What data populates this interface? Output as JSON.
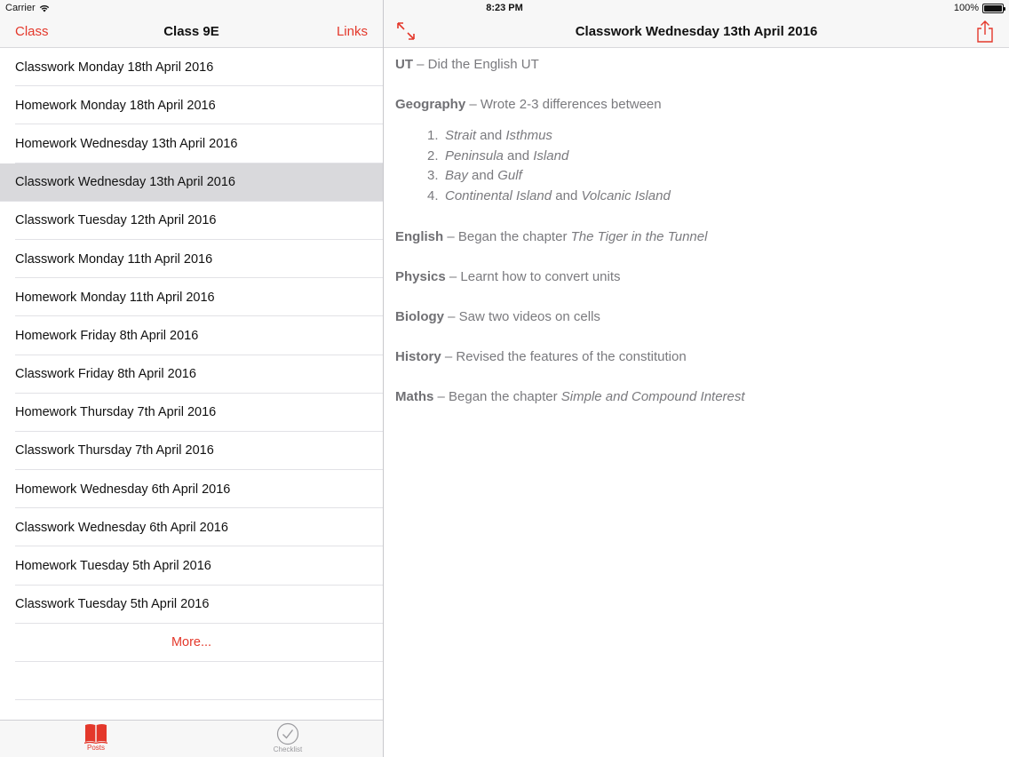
{
  "status_bar": {
    "carrier": "Carrier",
    "time": "8:23 PM",
    "battery": "100%"
  },
  "master": {
    "nav": {
      "left": "Class",
      "title": "Class 9E",
      "right": "Links"
    },
    "items": [
      "Classwork Monday 18th April 2016",
      "Homework Monday 18th April 2016",
      "Homework Wednesday 13th April 2016",
      "Classwork Wednesday 13th April 2016",
      "Classwork Tuesday 12th April 2016",
      "Classwork Monday 11th April 2016",
      "Homework Monday 11th April 2016",
      "Homework Friday 8th April 2016",
      "Classwork Friday 8th April 2016",
      "Homework Thursday 7th April 2016",
      "Classwork Thursday 7th April 2016",
      "Homework Wednesday 6th April 2016",
      "Classwork Wednesday 6th April 2016",
      "Homework Tuesday 5th April 2016",
      "Classwork Tuesday 5th April 2016"
    ],
    "selected_index": 3,
    "more": "More...",
    "tabs": [
      {
        "label": "Posts",
        "icon": "book-icon",
        "active": true
      },
      {
        "label": "Checklist",
        "icon": "checkmark-circle-icon",
        "active": false
      }
    ]
  },
  "detail": {
    "title": "Classwork Wednesday 13th April 2016",
    "ut": {
      "subject": "UT",
      "text": " – Did the English UT"
    },
    "geography": {
      "subject": "Geography",
      "text": " – Wrote 2-3 differences between",
      "list": [
        {
          "num": "1.",
          "a": "Strait",
          "and": " and ",
          "b": "Isthmus"
        },
        {
          "num": "2.",
          "a": "Peninsula",
          "and": " and ",
          "b": "Island"
        },
        {
          "num": "3.",
          "a": "Bay",
          "and": " and ",
          "b": "Gulf"
        },
        {
          "num": "4.",
          "a": "Continental Island",
          "and": " and ",
          "b": "Volcanic Island"
        }
      ]
    },
    "english": {
      "subject": "English",
      "text": " – Began the chapter ",
      "italic": "The Tiger in the Tunnel"
    },
    "physics": {
      "subject": "Physics",
      "text": " – Learnt how to convert units"
    },
    "biology": {
      "subject": "Biology",
      "text": " – Saw two videos on cells"
    },
    "history": {
      "subject": "History",
      "text": " – Revised the features of the constitution"
    },
    "maths": {
      "subject": "Maths",
      "text": " – Began the chapter ",
      "italic": "Simple and Compound Interest"
    }
  },
  "colors": {
    "accent": "#e4382b",
    "selected_row": "#d9d9dc",
    "detail_text": "#7a7a7e"
  }
}
